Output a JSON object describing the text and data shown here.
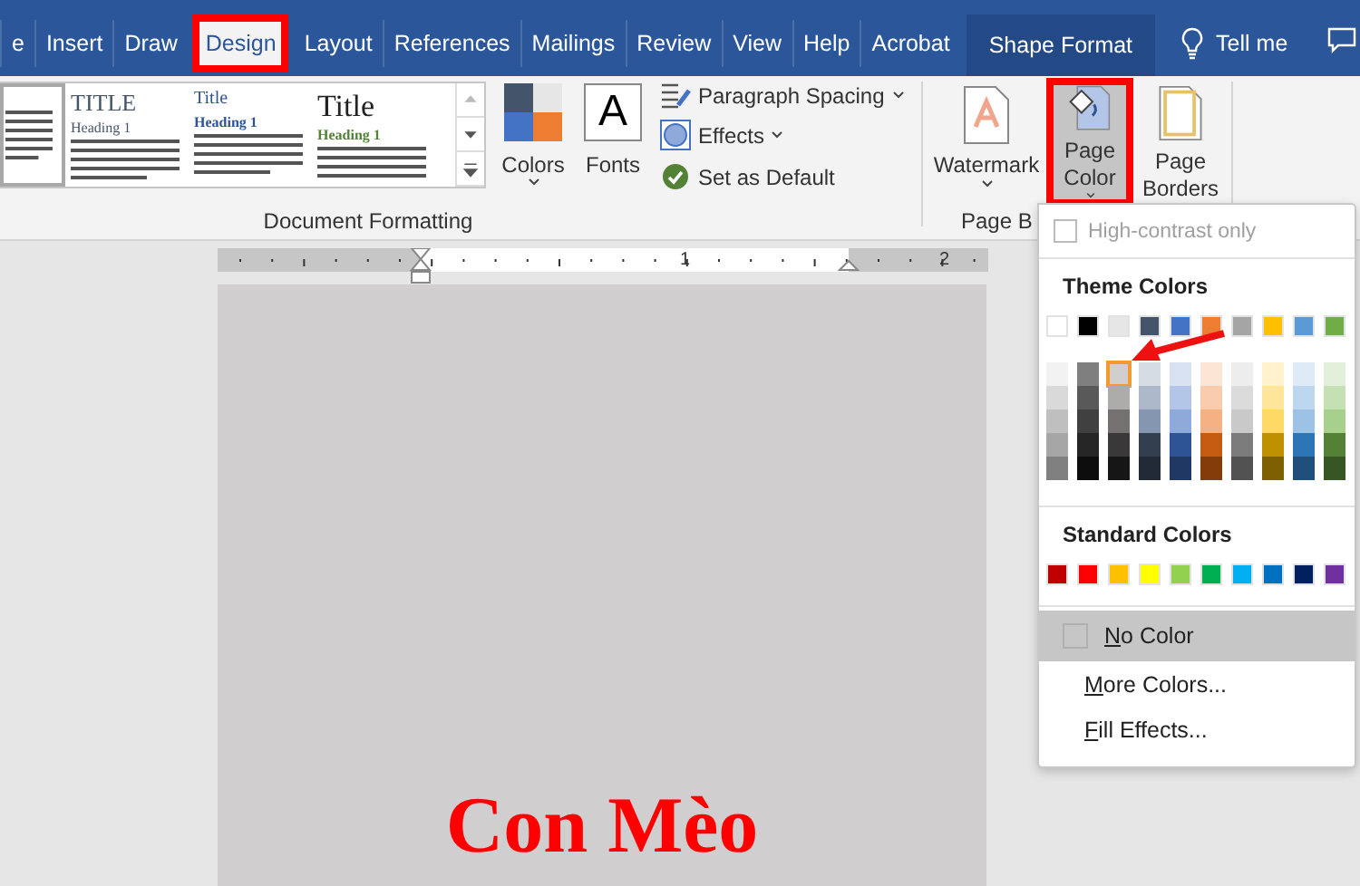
{
  "tabs": [
    {
      "label": "e",
      "selected": false,
      "contextual": false
    },
    {
      "label": "Insert",
      "selected": false,
      "contextual": false
    },
    {
      "label": "Draw",
      "selected": false,
      "contextual": false
    },
    {
      "label": "Design",
      "selected": true,
      "contextual": false
    },
    {
      "label": "Layout",
      "selected": false,
      "contextual": false
    },
    {
      "label": "References",
      "selected": false,
      "contextual": false
    },
    {
      "label": "Mailings",
      "selected": false,
      "contextual": false
    },
    {
      "label": "Review",
      "selected": false,
      "contextual": false
    },
    {
      "label": "View",
      "selected": false,
      "contextual": false
    },
    {
      "label": "Help",
      "selected": false,
      "contextual": false
    },
    {
      "label": "Acrobat",
      "selected": false,
      "contextual": false
    },
    {
      "label": "Shape Format",
      "selected": false,
      "contextual": true
    }
  ],
  "tell_me": "Tell me",
  "style_gallery": [
    {
      "kind": "cut"
    },
    {
      "kind": "gray",
      "title": "TITLE",
      "heading": "Heading 1"
    },
    {
      "kind": "blue",
      "title": "Title",
      "heading": "Heading 1"
    },
    {
      "kind": "green",
      "title": "Title",
      "heading": "Heading 1"
    }
  ],
  "colors_button": {
    "label": "Colors"
  },
  "fonts_button": {
    "glyph": "A",
    "label": "Fonts"
  },
  "format_commands": [
    {
      "kind": "spacing",
      "label": "Paragraph Spacing",
      "dropdown": true
    },
    {
      "kind": "effects",
      "label": "Effects",
      "dropdown": true
    },
    {
      "kind": "default",
      "label": "Set as Default",
      "dropdown": false
    }
  ],
  "groups": [
    "Document Formatting",
    "Page B"
  ],
  "page_buttons": [
    {
      "kind": "watermark",
      "label": "Watermark",
      "selected": false
    },
    {
      "kind": "color",
      "label": "Page Color",
      "selected": true
    },
    {
      "kind": "borders",
      "label": "Page Borders",
      "selected": false
    }
  ],
  "ruler": {
    "labels": [
      "1",
      "2"
    ]
  },
  "document": {
    "heading": "Con Mèo"
  },
  "color_menu": {
    "high_contrast": {
      "label": "High-contrast only",
      "checked": false,
      "disabled": true
    },
    "theme_title": "Theme Colors",
    "theme_colors": [
      {
        "color": "#ffffff",
        "selected": false,
        "shades": [
          {
            "color": "#f2f2f2",
            "selected": false
          },
          {
            "color": "#d9d9d9",
            "selected": false
          },
          {
            "color": "#bfbfbf",
            "selected": false
          },
          {
            "color": "#a6a6a6",
            "selected": false
          },
          {
            "color": "#808080",
            "selected": false
          }
        ]
      },
      {
        "color": "#000000",
        "selected": false,
        "shades": [
          {
            "color": "#7f7f7f",
            "selected": false
          },
          {
            "color": "#595959",
            "selected": false
          },
          {
            "color": "#404040",
            "selected": false
          },
          {
            "color": "#262626",
            "selected": false
          },
          {
            "color": "#0d0d0d",
            "selected": false
          }
        ]
      },
      {
        "color": "#e7e6e6",
        "selected": false,
        "shades": [
          {
            "color": "#d0cece",
            "selected": true
          },
          {
            "color": "#aeabab",
            "selected": false
          },
          {
            "color": "#757171",
            "selected": false
          },
          {
            "color": "#3a3838",
            "selected": false
          },
          {
            "color": "#171616",
            "selected": false
          }
        ]
      },
      {
        "color": "#44546a",
        "selected": false,
        "shades": [
          {
            "color": "#d6dce4",
            "selected": false
          },
          {
            "color": "#adb9ca",
            "selected": false
          },
          {
            "color": "#8496b0",
            "selected": false
          },
          {
            "color": "#333f4f",
            "selected": false
          },
          {
            "color": "#222a35",
            "selected": false
          }
        ]
      },
      {
        "color": "#4472c4",
        "selected": false,
        "shades": [
          {
            "color": "#d9e2f3",
            "selected": false
          },
          {
            "color": "#b4c6e7",
            "selected": false
          },
          {
            "color": "#8eaadb",
            "selected": false
          },
          {
            "color": "#2f5496",
            "selected": false
          },
          {
            "color": "#1f3864",
            "selected": false
          }
        ]
      },
      {
        "color": "#ed7d31",
        "selected": false,
        "shades": [
          {
            "color": "#fbe5d5",
            "selected": false
          },
          {
            "color": "#f7cbac",
            "selected": false
          },
          {
            "color": "#f4b183",
            "selected": false
          },
          {
            "color": "#c55a11",
            "selected": false
          },
          {
            "color": "#843c0b",
            "selected": false
          }
        ]
      },
      {
        "color": "#a5a5a5",
        "selected": false,
        "shades": [
          {
            "color": "#ededed",
            "selected": false
          },
          {
            "color": "#dbdbdb",
            "selected": false
          },
          {
            "color": "#c9c9c9",
            "selected": false
          },
          {
            "color": "#7b7b7b",
            "selected": false
          },
          {
            "color": "#525252",
            "selected": false
          }
        ]
      },
      {
        "color": "#ffc000",
        "selected": false,
        "shades": [
          {
            "color": "#fff2cc",
            "selected": false
          },
          {
            "color": "#fee599",
            "selected": false
          },
          {
            "color": "#ffd965",
            "selected": false
          },
          {
            "color": "#bf9000",
            "selected": false
          },
          {
            "color": "#7f6000",
            "selected": false
          }
        ]
      },
      {
        "color": "#5b9bd5",
        "selected": false,
        "shades": [
          {
            "color": "#deebf6",
            "selected": false
          },
          {
            "color": "#bdd7ee",
            "selected": false
          },
          {
            "color": "#9cc3e5",
            "selected": false
          },
          {
            "color": "#2e75b5",
            "selected": false
          },
          {
            "color": "#1e4e79",
            "selected": false
          }
        ]
      },
      {
        "color": "#70ad47",
        "selected": false,
        "shades": [
          {
            "color": "#e2efd9",
            "selected": false
          },
          {
            "color": "#c5e0b3",
            "selected": false
          },
          {
            "color": "#a8d08d",
            "selected": false
          },
          {
            "color": "#538135",
            "selected": false
          },
          {
            "color": "#375623",
            "selected": false
          }
        ]
      }
    ],
    "standard_title": "Standard Colors",
    "standard_colors": [
      {
        "color": "#c00000",
        "selected": false
      },
      {
        "color": "#ff0000",
        "selected": false
      },
      {
        "color": "#ffc000",
        "selected": false
      },
      {
        "color": "#ffff00",
        "selected": false
      },
      {
        "color": "#92d050",
        "selected": false
      },
      {
        "color": "#00b050",
        "selected": false
      },
      {
        "color": "#00b0f0",
        "selected": false
      },
      {
        "color": "#0070c0",
        "selected": false
      },
      {
        "color": "#002060",
        "selected": false
      },
      {
        "color": "#7030a0",
        "selected": false
      }
    ],
    "items": [
      {
        "kind": "swatch",
        "label": "No Color",
        "selected": true,
        "underline_first": true
      },
      {
        "kind": "plain",
        "label": "More Colors...",
        "selected": false,
        "underline_first": true
      },
      {
        "kind": "plain",
        "label": "Fill Effects...",
        "selected": false,
        "underline_first": true
      }
    ]
  },
  "annotations": [
    {
      "kind": "box"
    },
    {
      "kind": "box"
    },
    {
      "kind": "arrow"
    }
  ]
}
